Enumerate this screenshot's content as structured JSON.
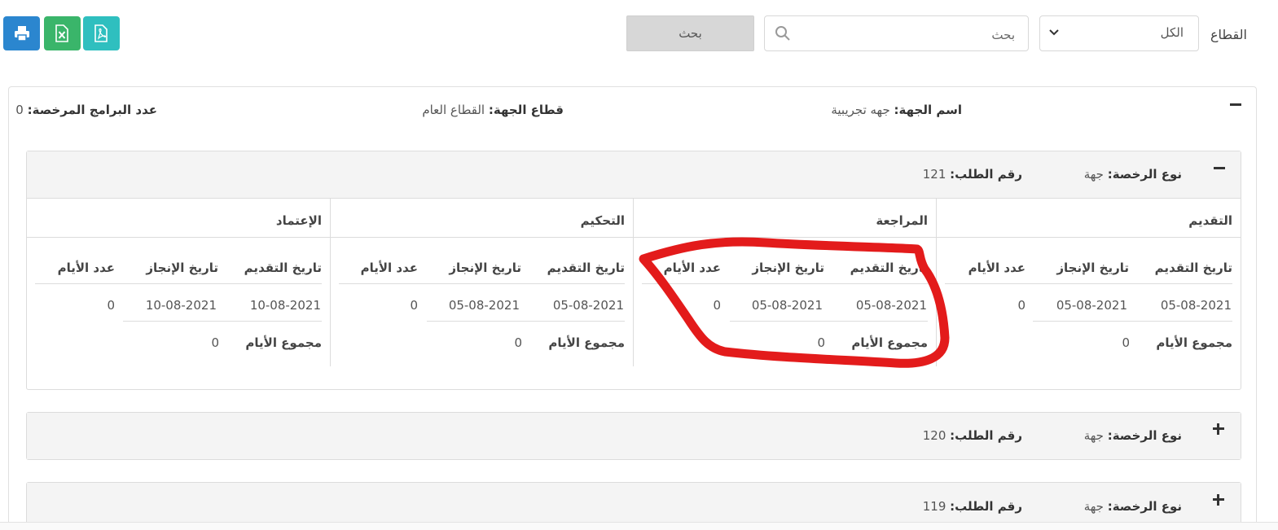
{
  "toolbar": {
    "sector_label": "القطاع",
    "sector_value": "الكل",
    "search_placeholder": "بحث",
    "search_button": "بحث",
    "buttons": {
      "print": "print-icon",
      "excel": "excel-icon",
      "pdf": "pdf-icon"
    },
    "colors": {
      "print": "#2b86cf",
      "excel": "#3ab56a",
      "pdf": "#2fbfbf"
    }
  },
  "entity": {
    "name_label": "اسم الجهة:",
    "name_value": "جهه تجريبية",
    "sector_label": "قطاع الجهة:",
    "sector_value": "القطاع العام",
    "programs_label": "عدد البرامج المرخصة:",
    "programs_value": "0"
  },
  "requests": [
    {
      "license_label": "نوع الرخصة:",
      "license_value": "جهة",
      "number_label": "رقم الطلب:",
      "number_value": "121",
      "expanded": true,
      "stages": [
        {
          "title": "التقديم",
          "col_submit": "تاريخ التقديم",
          "col_done": "تاريخ الإنجاز",
          "col_days": "عدد الأيام",
          "submit": "05-08-2021",
          "done": "05-08-2021",
          "days": "0",
          "total_label": "مجموع الأيام",
          "total": "0"
        },
        {
          "title": "المراجعة",
          "col_submit": "تاريخ التقديم",
          "col_done": "تاريخ الإنجاز",
          "col_days": "عدد الأيام",
          "submit": "05-08-2021",
          "done": "05-08-2021",
          "days": "0",
          "total_label": "مجموع الأيام",
          "total": "0"
        },
        {
          "title": "التحكيم",
          "col_submit": "تاريخ التقديم",
          "col_done": "تاريخ الإنجاز",
          "col_days": "عدد الأيام",
          "submit": "05-08-2021",
          "done": "05-08-2021",
          "days": "0",
          "total_label": "مجموع الأيام",
          "total": "0"
        },
        {
          "title": "الإعتماد",
          "col_submit": "تاريخ التقديم",
          "col_done": "تاريخ الإنجاز",
          "col_days": "عدد الأيام",
          "submit": "10-08-2021",
          "done": "10-08-2021",
          "days": "0",
          "total_label": "مجموع الأيام",
          "total": "0"
        }
      ]
    },
    {
      "license_label": "نوع الرخصة:",
      "license_value": "جهة",
      "number_label": "رقم الطلب:",
      "number_value": "120",
      "expanded": false
    },
    {
      "license_label": "نوع الرخصة:",
      "license_value": "جهة",
      "number_label": "رقم الطلب:",
      "number_value": "119",
      "expanded": false
    }
  ],
  "annotation": {
    "color": "#e31b1b",
    "circled_stage": "المراجعة"
  }
}
